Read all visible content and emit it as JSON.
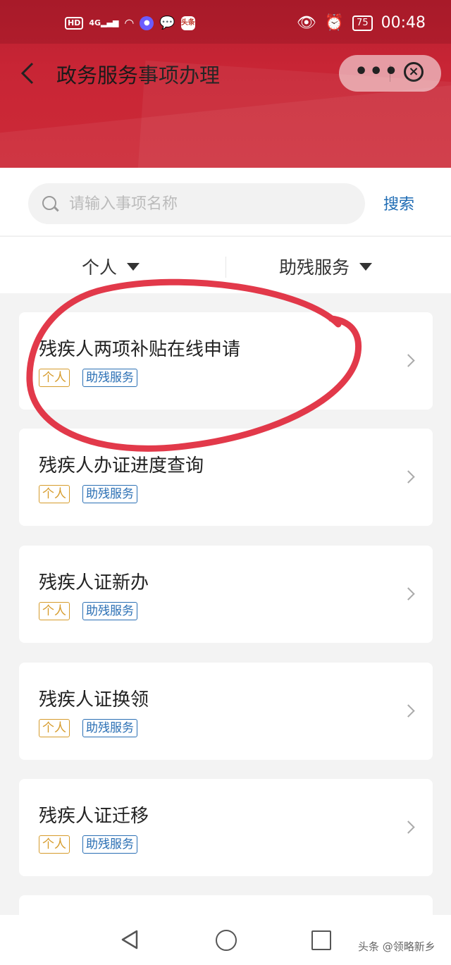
{
  "status_bar": {
    "hd": "HD",
    "network": "4G",
    "app_badge": "头条",
    "battery": "75",
    "time": "00:48"
  },
  "header": {
    "title": "政务服务事项办理",
    "more_label": "•••",
    "close_label": "×"
  },
  "search": {
    "placeholder": "请输入事项名称",
    "button_label": "搜索"
  },
  "filters": [
    {
      "label": "个人"
    },
    {
      "label": "助残服务"
    }
  ],
  "items": [
    {
      "title": "残疾人两项补贴在线申请",
      "tags": [
        "个人",
        "助残服务"
      ]
    },
    {
      "title": "残疾人办证进度查询",
      "tags": [
        "个人",
        "助残服务"
      ]
    },
    {
      "title": "残疾人证新办",
      "tags": [
        "个人",
        "助残服务"
      ]
    },
    {
      "title": "残疾人证换领",
      "tags": [
        "个人",
        "助残服务"
      ]
    },
    {
      "title": "残疾人证迁移",
      "tags": [
        "个人",
        "助残服务"
      ]
    }
  ],
  "watermark": "头条 @领略新乡",
  "colors": {
    "header_red": "#c82535",
    "link_blue": "#1f6cb4",
    "tag_orange": "#d69b2b",
    "tag_blue": "#2a6fb4",
    "annotation_red": "#e0283b"
  }
}
